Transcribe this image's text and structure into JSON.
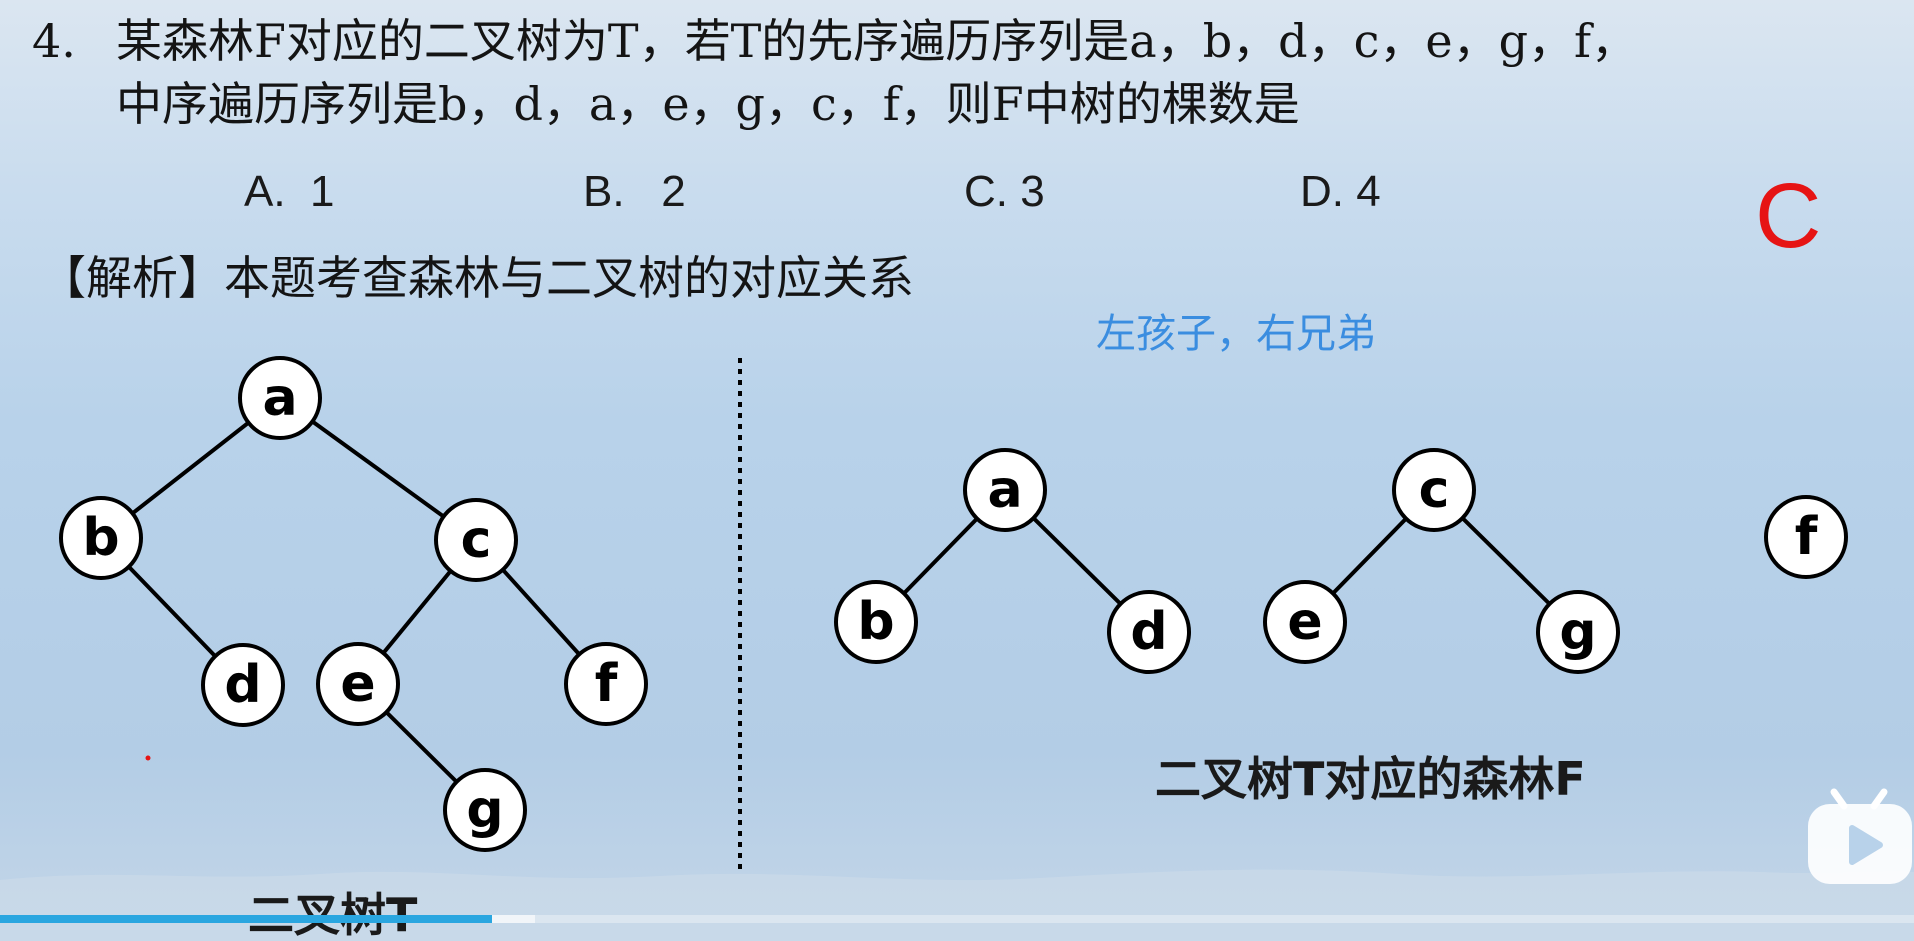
{
  "question": {
    "number": "4.",
    "line1": "某森林F对应的二叉树为T，若T的先序遍历序列是a，b，d，c，e，g，f，",
    "line2": "中序遍历序列是b，d，a，e，g，c，f，则F中树的棵数是"
  },
  "options": [
    {
      "label": "A.  1"
    },
    {
      "label": "B.   2"
    },
    {
      "label": "C. 3"
    },
    {
      "label": "D. 4"
    }
  ],
  "answer": "C",
  "analysis": "【解析】本题考查森林与二叉树的对应关系",
  "hint": "左孩子，右兄弟",
  "binary_tree": {
    "caption": "二叉树T",
    "nodes": [
      "a",
      "b",
      "c",
      "d",
      "e",
      "f",
      "g"
    ]
  },
  "forest": {
    "caption": "二叉树T对应的森林F",
    "nodes": [
      "a",
      "b",
      "d",
      "c",
      "e",
      "g",
      "f"
    ]
  },
  "colors": {
    "answer": "#e61414",
    "hint": "#3a8de0",
    "progress": "#2aa6e0"
  },
  "player": {
    "progress": 0.257
  }
}
